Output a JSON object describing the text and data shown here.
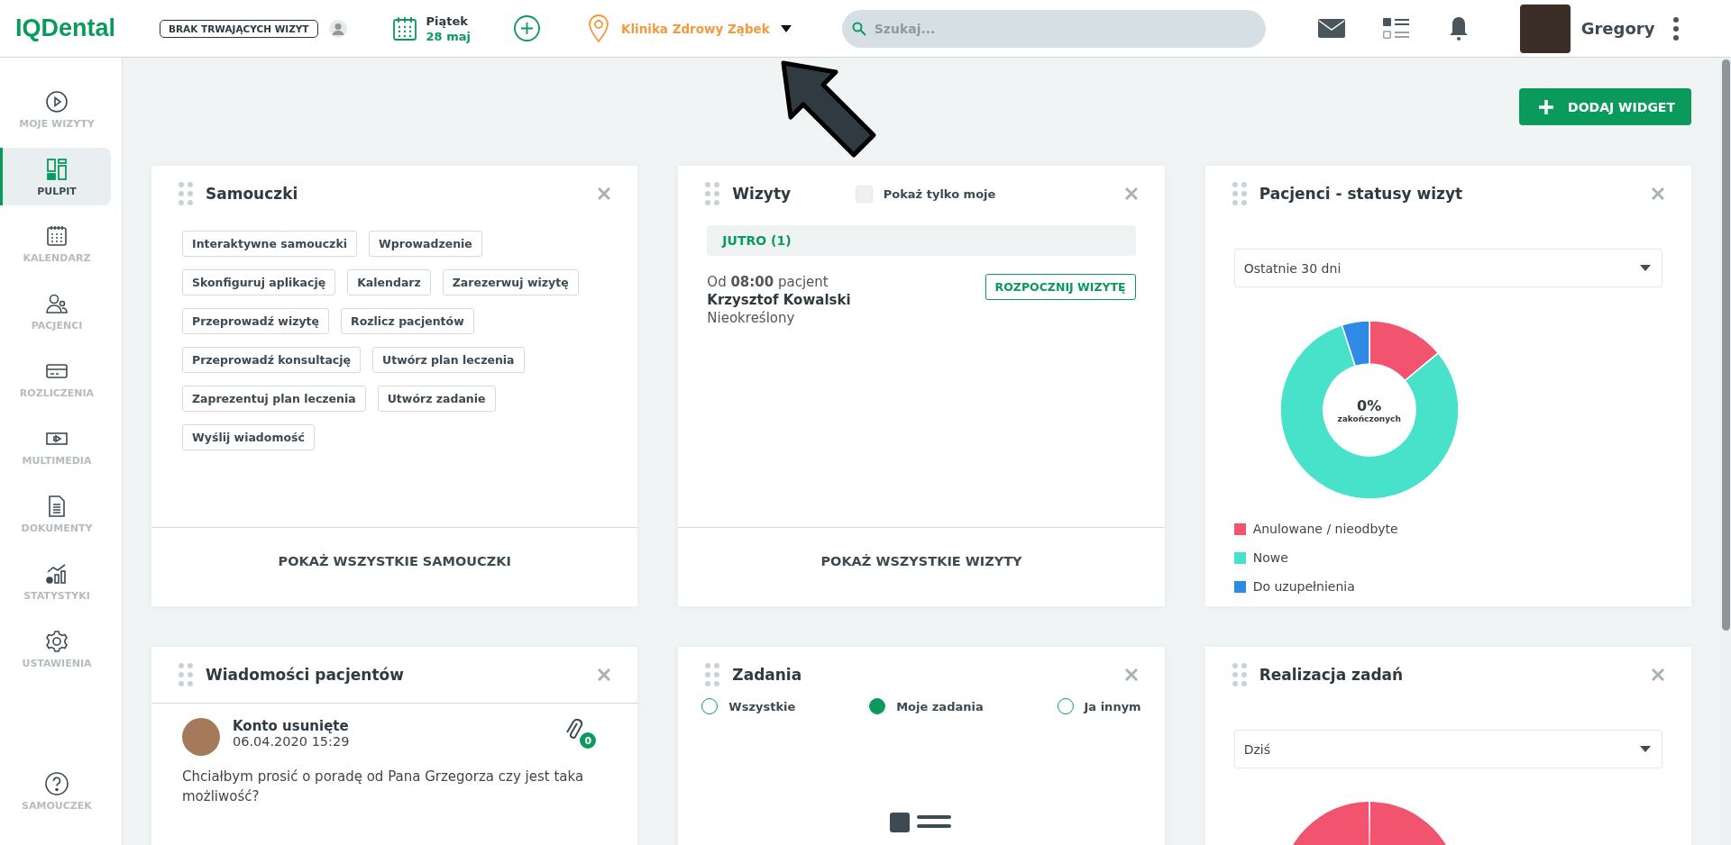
{
  "header": {
    "logo": "IQDental",
    "visit_status": "BRAK TRWAJĄCYCH WIZYT",
    "date": {
      "day": "Piątek",
      "date": "28 maj"
    },
    "clinic": "Klinika Zdrowy Ząbek",
    "search": {
      "placeholder": "Szukaj..."
    },
    "user": {
      "name": "Gregory"
    }
  },
  "sidebar": {
    "items": [
      {
        "kind": "visits",
        "label": "MOJE WIZYTY",
        "selected": false
      },
      {
        "kind": "dashboard",
        "label": "PULPIT",
        "selected": true
      },
      {
        "kind": "calendar",
        "label": "KALENDARZ",
        "selected": false
      },
      {
        "kind": "patients",
        "label": "PACJENCI",
        "selected": false
      },
      {
        "kind": "billing",
        "label": "ROZLICZENIA",
        "selected": false
      },
      {
        "kind": "multimedia",
        "label": "MULTIMEDIA",
        "selected": false
      },
      {
        "kind": "documents",
        "label": "DOKUMENTY",
        "selected": false
      },
      {
        "kind": "statistics",
        "label": "STATYSTYKI",
        "selected": false
      },
      {
        "kind": "settings",
        "label": "USTAWIENIA",
        "selected": false
      }
    ],
    "help": {
      "label": "SAMOUCZEK"
    }
  },
  "add_widget_button": "DODAJ WIDGET",
  "widgets": [
    {
      "kind": "tutorials",
      "title": "Samouczki",
      "chips": [
        "Interaktywne samouczki",
        "Wprowadzenie",
        "Skonfiguruj aplikację",
        "Kalendarz",
        "Zarezerwuj wizytę",
        "Przeprowadź wizytę",
        "Rozlicz pacjentów",
        "Przeprowadź konsultację",
        "Utwórz plan leczenia",
        "Zaprezentuj plan leczenia",
        "Utwórz zadanie",
        "Wyślij wiadomość"
      ],
      "footer": "POKAŻ WSZYSTKIE SAMOUCZKI"
    },
    {
      "kind": "visits",
      "title": "Wizyty",
      "only_mine": {
        "label": "Pokaż tylko moje",
        "checked": false
      },
      "group": "JUTRO (1)",
      "visit": {
        "time": "Od **08:00** pacjent",
        "patient": "Krzysztof Kowalski",
        "status": "Nieokreślony",
        "button": "ROZPOCZNIJ WIZYTĘ"
      },
      "footer": "POKAŻ WSZYSTKIE WIZYTY"
    },
    {
      "kind": "statuses",
      "title": "Pacjenci - statusy wizyt",
      "period": "Ostatnie 30 dni",
      "center_value": "0%",
      "center_label": "zakończonych",
      "legend": [
        {
          "label": "Anulowane / nieodbyte",
          "color": "#f25470"
        },
        {
          "label": "Nowe",
          "color": "#48e1c9"
        },
        {
          "label": "Do uzupełnienia",
          "color": "#2f8ae6"
        }
      ]
    },
    {
      "kind": "messages",
      "title": "Wiadomości pacjentów",
      "message": {
        "sender": "Konto usunięte",
        "date": "06.04.2020 15:29",
        "attachments": "0",
        "text": "Chciałbym prosić o poradę od Pana Grzegorza czy jest taka możliwość?"
      }
    },
    {
      "kind": "tasks",
      "title": "Zadania",
      "filters": [
        {
          "label": "Wszystkie",
          "selected": false
        },
        {
          "label": "Moje zadania",
          "selected": true
        },
        {
          "label": "Ja innym",
          "selected": false
        }
      ]
    },
    {
      "kind": "completion",
      "title": "Realizacja zadań",
      "period": "Dziś"
    }
  ]
}
